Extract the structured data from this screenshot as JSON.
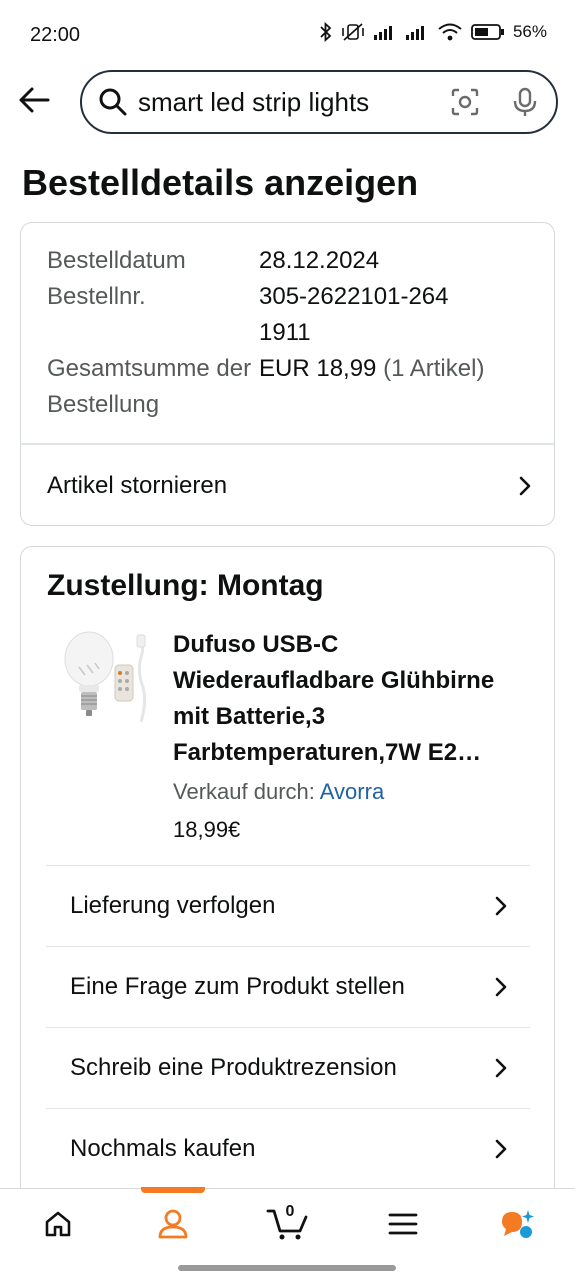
{
  "status_bar": {
    "time": "22:00",
    "battery": "56%"
  },
  "search": {
    "query": "smart led strip lights"
  },
  "page": {
    "title": "Bestelldetails anzeigen"
  },
  "summary": {
    "rows": [
      {
        "label": "Bestelldatum",
        "value": "28.12.2024"
      },
      {
        "label": "Bestellnr.",
        "value": "305-2622101-2641911"
      },
      {
        "label": "Gesamtsumme der Bestellung",
        "value": "EUR 18,99",
        "extra": "(1 Artikel)"
      }
    ],
    "cancel_label": "Artikel stornieren"
  },
  "delivery": {
    "title": "Zustellung: Montag",
    "product_title": "Dufuso USB-C Wiederaufladbare Glühbirne mit Batterie,3 Farbtemperaturen,7W E2…",
    "seller_prefix": "Verkauf durch:",
    "seller_name": "Avorra",
    "price": "18,99€",
    "actions": [
      {
        "label": "Lieferung verfolgen"
      },
      {
        "label": "Eine Frage zum Produkt stellen"
      },
      {
        "label": "Schreib eine Produktrezension"
      },
      {
        "label": "Nochmals kaufen"
      }
    ]
  },
  "bottom_nav": {
    "items": [
      "home-icon",
      "account-icon",
      "cart-icon",
      "menu-icon",
      "rufus-icon"
    ],
    "active": "account-icon",
    "cart_count": "0"
  },
  "colors": {
    "accent": "#f47b24",
    "link": "#2162a1",
    "muted": "#565959",
    "border": "#d5d9d9"
  }
}
